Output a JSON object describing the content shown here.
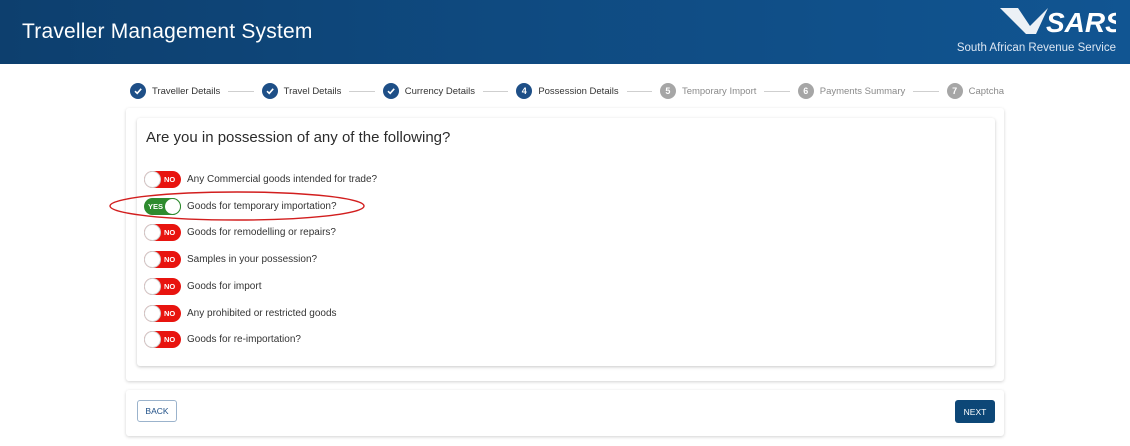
{
  "header": {
    "title": "Traveller Management System",
    "logo_text": "SARS",
    "logo_subtitle": "South African Revenue Service"
  },
  "stepper": {
    "steps": [
      {
        "label": "Traveller Details",
        "state": "done",
        "icon": "check-icon"
      },
      {
        "label": "Travel Details",
        "state": "done",
        "icon": "check-icon"
      },
      {
        "label": "Currency Details",
        "state": "done",
        "icon": "check-icon"
      },
      {
        "label": "Possession Details",
        "state": "active",
        "number": "4"
      },
      {
        "label": "Temporary Import",
        "state": "pending",
        "number": "5"
      },
      {
        "label": "Payments Summary",
        "state": "pending",
        "number": "6"
      },
      {
        "label": "Captcha",
        "state": "pending",
        "number": "7"
      }
    ]
  },
  "form": {
    "question": "Are you in possession of any of the following?",
    "items": [
      {
        "label": "Any Commercial goods intended for trade?",
        "toggle": "NO"
      },
      {
        "label": "Goods for temporary importation?",
        "toggle": "YES"
      },
      {
        "label": "Goods for remodelling or repairs?",
        "toggle": "NO"
      },
      {
        "label": "Samples in your possession?",
        "toggle": "NO"
      },
      {
        "label": "Goods for import",
        "toggle": "NO"
      },
      {
        "label": "Any prohibited or restricted goods",
        "toggle": "NO"
      },
      {
        "label": "Goods for re-importation?",
        "toggle": "NO"
      }
    ]
  },
  "actions": {
    "back_label": "BACK",
    "next_label": "NEXT"
  },
  "colors": {
    "header_dark": "#0d3f6e",
    "step_active": "#1e4f87",
    "toggle_no": "#e8140f",
    "toggle_yes": "#2e8b2e",
    "highlight": "#d21e1e",
    "next_button": "#0d4777"
  }
}
